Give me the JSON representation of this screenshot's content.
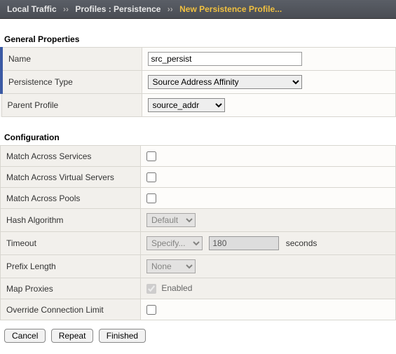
{
  "breadcrumb": {
    "item1": "Local Traffic",
    "item2": "Profiles : Persistence",
    "current": "New Persistence Profile..."
  },
  "sections": {
    "general": "General Properties",
    "config": "Configuration"
  },
  "general": {
    "name_label": "Name",
    "name_value": "src_persist",
    "ptype_label": "Persistence Type",
    "ptype_value": "Source Address Affinity",
    "parent_label": "Parent Profile",
    "parent_value": "source_addr"
  },
  "config": {
    "match_services_label": "Match Across Services",
    "match_virtual_label": "Match Across Virtual Servers",
    "match_pools_label": "Match Across Pools",
    "hash_label": "Hash Algorithm",
    "hash_value": "Default",
    "timeout_label": "Timeout",
    "timeout_mode": "Specify...",
    "timeout_value": "180",
    "timeout_suffix": "seconds",
    "prefix_label": "Prefix Length",
    "prefix_value": "None",
    "map_proxies_label": "Map Proxies",
    "map_proxies_enabled": "Enabled",
    "override_label": "Override Connection Limit"
  },
  "buttons": {
    "cancel": "Cancel",
    "repeat": "Repeat",
    "finished": "Finished"
  }
}
